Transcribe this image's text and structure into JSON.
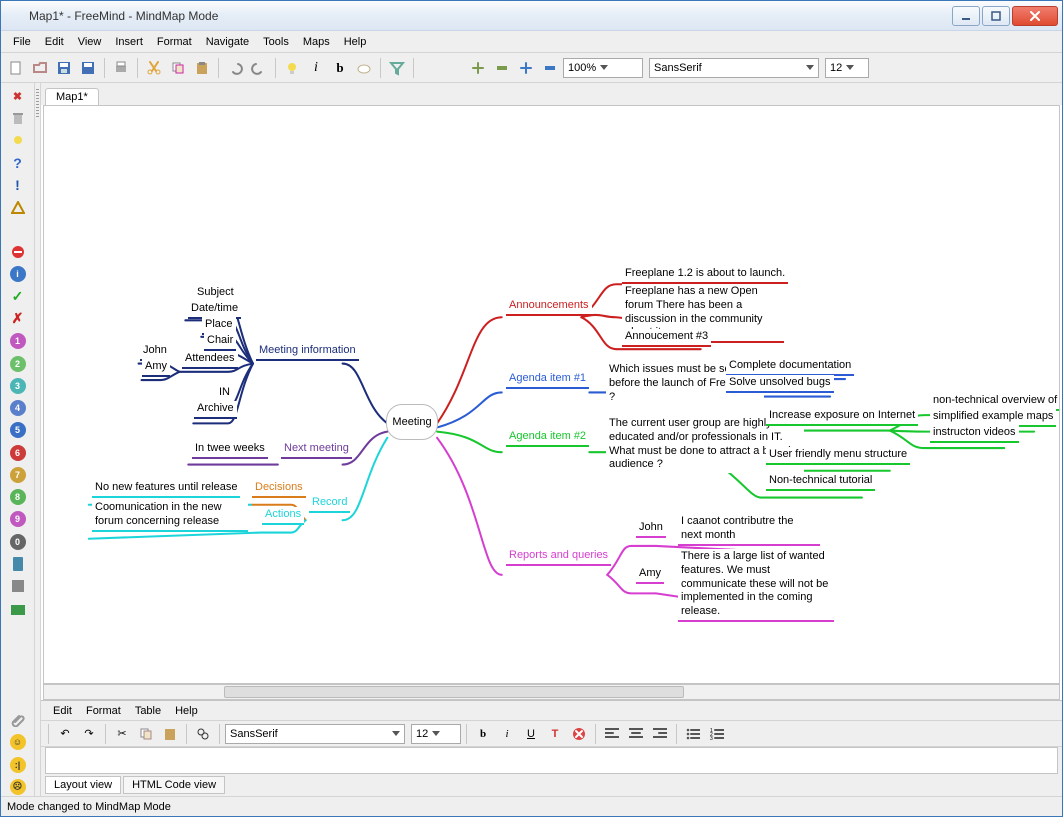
{
  "title": "Map1* - FreeMind - MindMap Mode",
  "menu": {
    "file": "File",
    "edit": "Edit",
    "view": "View",
    "insert": "Insert",
    "format": "Format",
    "navigate": "Navigate",
    "tools": "Tools",
    "maps": "Maps",
    "help": "Help"
  },
  "toolbar": {
    "zoom": "100%",
    "font": "SansSerif",
    "size": "12"
  },
  "tab": "Map1*",
  "status": "Mode changed to MindMap Mode",
  "editor": {
    "menu": {
      "edit": "Edit",
      "format": "Format",
      "table": "Table",
      "help": "Help"
    },
    "font": "SansSerif",
    "size": "12",
    "tabs": {
      "layout": "Layout view",
      "html": "HTML Code view"
    }
  },
  "colors": {
    "navy": "#1c2d7a",
    "red": "#cc1f1f",
    "blue": "#2b5cd4",
    "green": "#17c72d",
    "cyan": "#1bd5da",
    "purple": "#6f3c9c",
    "orange": "#d97c1b",
    "magenta": "#d63ed0"
  },
  "mindmap": {
    "root": "Meeting",
    "left": {
      "meeting_info": {
        "label": "Meeting information",
        "children": {
          "subject": "Subject",
          "datetime": "Date/time",
          "place": "Place",
          "chair": "Chair",
          "attendees": {
            "label": "Attendees",
            "children": {
              "john": "John",
              "amy": "Amy"
            }
          },
          "in": "IN",
          "archive": "Archive"
        }
      },
      "next_meeting": {
        "label": "Next meeting",
        "children": {
          "in_two": "In twee weeks"
        }
      },
      "record": {
        "label": "Record",
        "children": {
          "decisions": {
            "label": "Decisions",
            "children": {
              "d1": "No new features until release"
            }
          },
          "actions": {
            "label": "Actions",
            "children": {
              "a1": "Coomunication in the new forum\nconcerning release"
            }
          }
        }
      }
    },
    "right": {
      "announcements": {
        "label": "Announcements",
        "children": {
          "a1": "Freeplane 1.2 is about to launch.",
          "a2": "Freeplane has a new Open forum\nThere has been a discussion in the\ncommunity about it.",
          "a3": "Annoucement #3"
        }
      },
      "agenda1": {
        "label": "Agenda item #1",
        "note": "Which issues must be solved\nbefore the launch of Freeplane ?",
        "children": {
          "c1": "Complete documentation",
          "c2": "Solve unsolved bugs"
        }
      },
      "agenda2": {
        "label": "Agenda item #2",
        "note": "The current user group are highly educated\nand/or professionals in IT. What must\nbe done to attract a broader audience ?",
        "children": {
          "e1": {
            "label": "Increase exposure on Internet",
            "children": {
              "s1": "non-technical overview of possibilities",
              "s2": "simplified example maps",
              "s3": "instructon videos"
            }
          },
          "e2": "User friendly menu structure",
          "e3": "Non-technical tutorial"
        }
      },
      "reports": {
        "label": "Reports and queries",
        "children": {
          "john": {
            "label": "John",
            "note": "I caanot contributre the\nnext month"
          },
          "amy": {
            "label": "Amy",
            "note": "There is a large list of wanted\nfeatures. We must communicate\nthese will not be implemented\nin the coming release."
          }
        }
      }
    }
  }
}
